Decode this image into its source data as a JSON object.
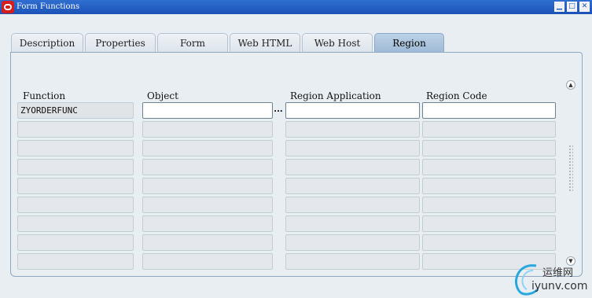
{
  "window": {
    "title": "Form Functions",
    "controls": {
      "minimize": "▁",
      "maximize": "□",
      "close": "✕"
    }
  },
  "tabs": [
    {
      "label": "Description",
      "active": false
    },
    {
      "label": "Properties",
      "active": false
    },
    {
      "label": "Form",
      "active": false
    },
    {
      "label": "Web HTML",
      "active": false
    },
    {
      "label": "Web Host",
      "active": false
    },
    {
      "label": "Region",
      "active": true
    }
  ],
  "columns": {
    "function": "Function",
    "object": "Object",
    "region_application": "Region Application",
    "region_code": "Region Code"
  },
  "rows": [
    {
      "function": "ZYORDERFUNC",
      "object": "",
      "region_application": "",
      "region_code": ""
    },
    {
      "function": "",
      "object": "",
      "region_application": "",
      "region_code": ""
    },
    {
      "function": "",
      "object": "",
      "region_application": "",
      "region_code": ""
    },
    {
      "function": "",
      "object": "",
      "region_application": "",
      "region_code": ""
    },
    {
      "function": "",
      "object": "",
      "region_application": "",
      "region_code": ""
    },
    {
      "function": "",
      "object": "",
      "region_application": "",
      "region_code": ""
    },
    {
      "function": "",
      "object": "",
      "region_application": "",
      "region_code": ""
    },
    {
      "function": "",
      "object": "",
      "region_application": "",
      "region_code": ""
    },
    {
      "function": "",
      "object": "",
      "region_application": "",
      "region_code": ""
    }
  ],
  "lov_button": "...",
  "scrollbar": {
    "up": "▲",
    "down": "▼"
  },
  "watermark": {
    "line1": "运维网",
    "line2": "iyunv.com"
  },
  "colors": {
    "titlebar": "#1c52b8",
    "active_tab": "#9ebad6",
    "app_icon": "#d51d1d"
  }
}
